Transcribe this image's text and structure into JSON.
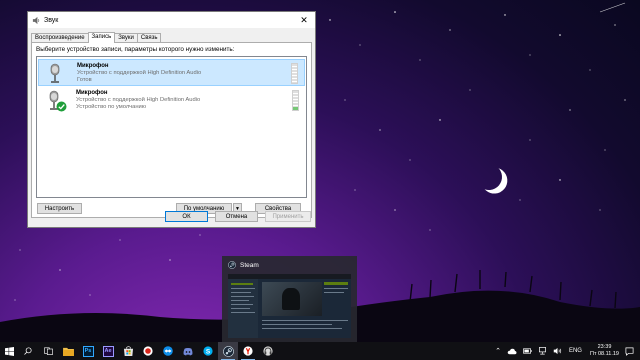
{
  "dialog": {
    "title": "Звук",
    "tabs": [
      "Воспроизведение",
      "Запись",
      "Звуки",
      "Связь"
    ],
    "active_tab": "Запись",
    "hint": "Выберите устройство записи, параметры которого нужно изменить:",
    "devices": [
      {
        "name": "Микрофон",
        "desc": "Устройство с поддержкой High Definition Audio",
        "status": "Готов",
        "selected": true,
        "default": false
      },
      {
        "name": "Микрофон",
        "desc": "Устройство с поддержкой High Definition Audio",
        "status": "Устройство по умолчанию",
        "selected": false,
        "default": true
      }
    ],
    "buttons": {
      "configure": "Настроить",
      "set_default": "По умолчанию",
      "properties": "Свойства",
      "ok": "ОК",
      "cancel": "Отмена",
      "apply": "Применить"
    }
  },
  "preview": {
    "title": "Steam"
  },
  "taskbar": {
    "icons": [
      "windows-start-icon",
      "search-icon",
      "task-view-icon",
      "file-explorer-icon",
      "photoshop-icon",
      "after-effects-icon",
      "ms-store-icon",
      "record-icon",
      "teamviewer-icon",
      "discord-icon",
      "skype-icon",
      "steam-icon",
      "yandex-browser-icon",
      "audacity-icon"
    ],
    "ps_label": "Ps",
    "ae_label": "Ae",
    "lang": "ENG",
    "time": "23:39",
    "date": "Пт 08.11.19"
  },
  "colors": {
    "accent": "#0078d7",
    "selection": "#cce8ff",
    "taskbar": "#101014"
  }
}
